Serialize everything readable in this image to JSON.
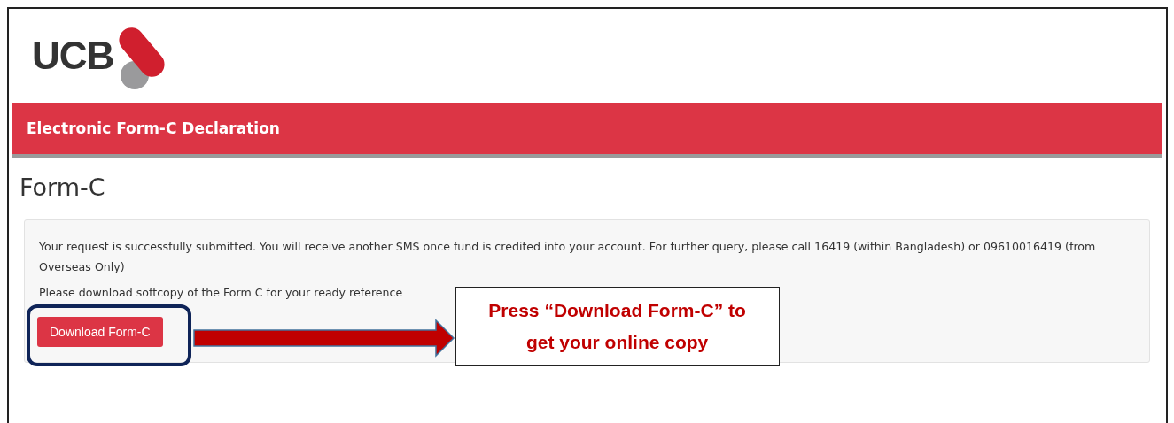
{
  "logo": {
    "text": "UCB"
  },
  "header": {
    "title": "Electronic Form-C Declaration"
  },
  "page_title": "Form-C",
  "panel": {
    "message": "Your request is successfully submitted. You will receive another SMS once fund is credited into your account. For further query, please call 16419 (within Bangladesh) or 09610016419 (from Overseas Only)",
    "instruction": "Please download softcopy of the Form C for your ready reference",
    "button": "Download Form-C"
  },
  "annotation": {
    "callout": "Press “Download Form-C” to get your online copy"
  }
}
